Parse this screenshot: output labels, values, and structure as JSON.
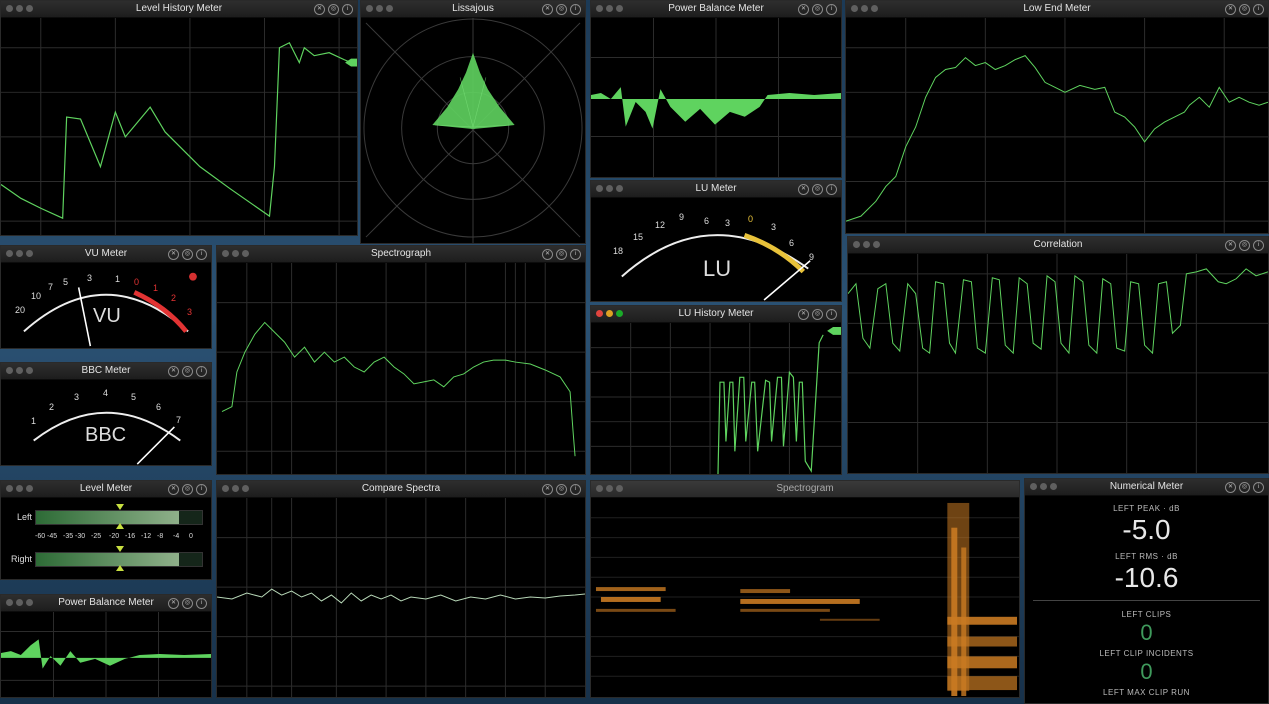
{
  "windows": {
    "level_history": {
      "title": "Level History Meter"
    },
    "lissajous": {
      "title": "Lissajous"
    },
    "power_balance_top": {
      "title": "Power Balance Meter"
    },
    "low_end": {
      "title": "Low End Meter"
    },
    "vu": {
      "title": "VU Meter",
      "big_label": "VU",
      "scale": [
        "20",
        "10",
        "7",
        "5",
        "3",
        "1",
        "0",
        "1",
        "2",
        "3"
      ]
    },
    "spectrograph": {
      "title": "Spectrograph"
    },
    "lu_meter": {
      "title": "LU Meter",
      "big_label": "LU",
      "scale": [
        "18",
        "15",
        "12",
        "9",
        "6",
        "3",
        "0",
        "3",
        "6",
        "9"
      ]
    },
    "correlation": {
      "title": "Correlation"
    },
    "bbc": {
      "title": "BBC Meter",
      "big_label": "BBC",
      "scale": [
        "1",
        "2",
        "3",
        "4",
        "5",
        "6",
        "7"
      ]
    },
    "lu_history": {
      "title": "LU History Meter"
    },
    "level_meter": {
      "title": "Level Meter",
      "left_label": "Left",
      "right_label": "Right",
      "scale": [
        "-60",
        "-45",
        "-35",
        "-30",
        "-25",
        "-20",
        "-16",
        "-12",
        "-8",
        "-4",
        "0"
      ]
    },
    "compare_spectra": {
      "title": "Compare Spectra"
    },
    "spectrogram": {
      "title": "Spectrogram"
    },
    "numerical": {
      "title": "Numerical Meter",
      "left_peak_label": "LEFT PEAK · dB",
      "left_peak_value": "-5.0",
      "left_rms_label": "LEFT RMS · dB",
      "left_rms_value": "-10.6",
      "left_clips_label": "LEFT CLIPS",
      "left_clips_value": "0",
      "left_clip_incidents_label": "LEFT CLIP INCIDENTS",
      "left_clip_incidents_value": "0",
      "left_max_clip_run_label": "LEFT MAX CLIP RUN"
    },
    "power_balance_bottom": {
      "title": "Power Balance Meter"
    }
  },
  "controls": {
    "close_icon": "✕",
    "pin_icon": "◎",
    "info_icon": "i"
  },
  "colors": {
    "trace_green": "#5fd35f",
    "bright_green": "#63e36a",
    "vu_red": "#e23333",
    "lu_yellow": "#e8c23a",
    "spectrogram_orange": "#c97a22"
  },
  "level_meter_state": {
    "left_fill": 0.86,
    "right_fill": 0.86
  }
}
